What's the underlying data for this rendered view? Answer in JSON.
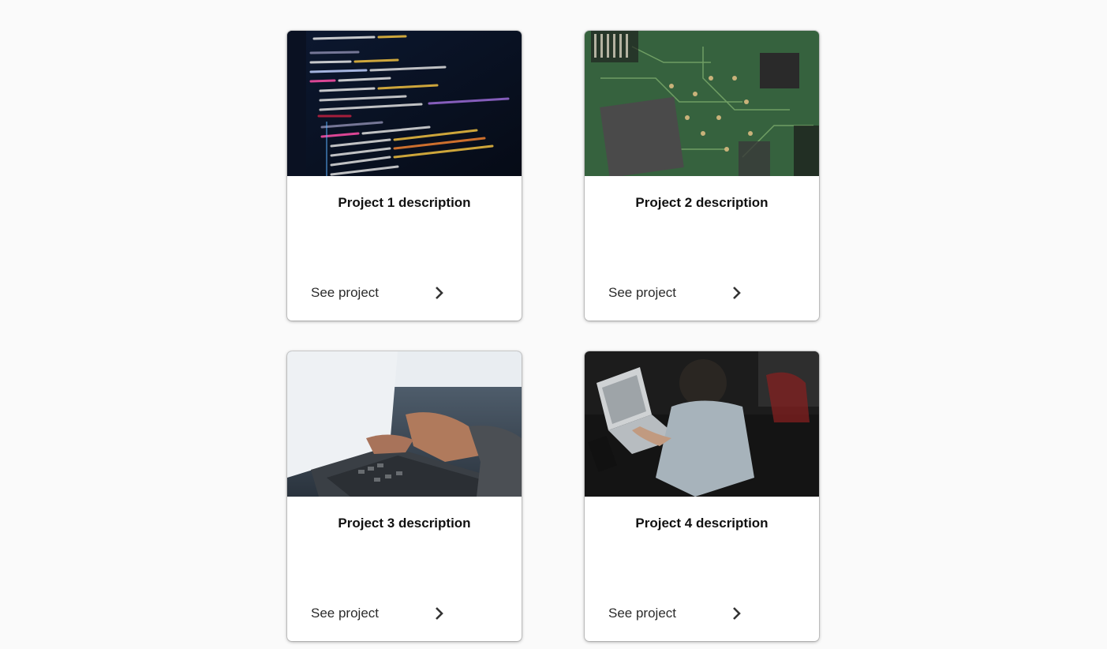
{
  "projects": [
    {
      "title": "Project 1 description",
      "link_label": "See project",
      "image": "code-editor-screen-photo"
    },
    {
      "title": "Project 2 description",
      "link_label": "See project",
      "image": "circuit-board-photo"
    },
    {
      "title": "Project 3 description",
      "link_label": "See project",
      "image": "laptop-typing-photo"
    },
    {
      "title": "Project 4 description",
      "link_label": "See project",
      "image": "person-with-laptop-photo"
    }
  ],
  "icons": {
    "link_arrow": "chevron-right-icon"
  },
  "colors": {
    "background": "#fafafa",
    "card": "#ffffff",
    "title": "#111111",
    "link": "#2b2b2b"
  }
}
